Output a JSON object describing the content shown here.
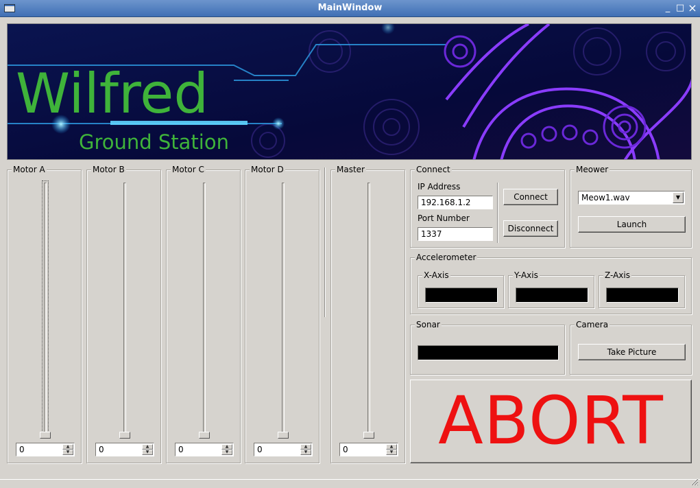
{
  "window": {
    "title": "MainWindow",
    "minimize": "_",
    "maximize": "□",
    "close": "×"
  },
  "banner": {
    "title": "Wilfred",
    "subtitle": "Ground Station"
  },
  "motors": [
    {
      "label": "Motor A",
      "value": "0"
    },
    {
      "label": "Motor B",
      "value": "0"
    },
    {
      "label": "Motor C",
      "value": "0"
    },
    {
      "label": "Motor D",
      "value": "0"
    }
  ],
  "master": {
    "label": "Master",
    "value": "0"
  },
  "connect": {
    "group_label": "Connect",
    "ip_label": "IP Address",
    "ip_value": "192.168.1.2",
    "port_label": "Port Number",
    "port_value": "1337",
    "connect_button": "Connect",
    "disconnect_button": "Disconnect"
  },
  "meower": {
    "group_label": "Meower",
    "selected_file": "Meow1.wav",
    "launch_button": "Launch"
  },
  "accelerometer": {
    "group_label": "Accelerometer",
    "x_label": "X-Axis",
    "y_label": "Y-Axis",
    "z_label": "Z-Axis"
  },
  "sonar": {
    "group_label": "Sonar"
  },
  "camera": {
    "group_label": "Camera",
    "take_picture_button": "Take Picture"
  },
  "abort_button": "ABORT",
  "colors": {
    "banner_text": "#3fb33a",
    "abort_text": "#ee1111",
    "background": "#d6d3ce",
    "titlebar": "#4f7fc0"
  }
}
